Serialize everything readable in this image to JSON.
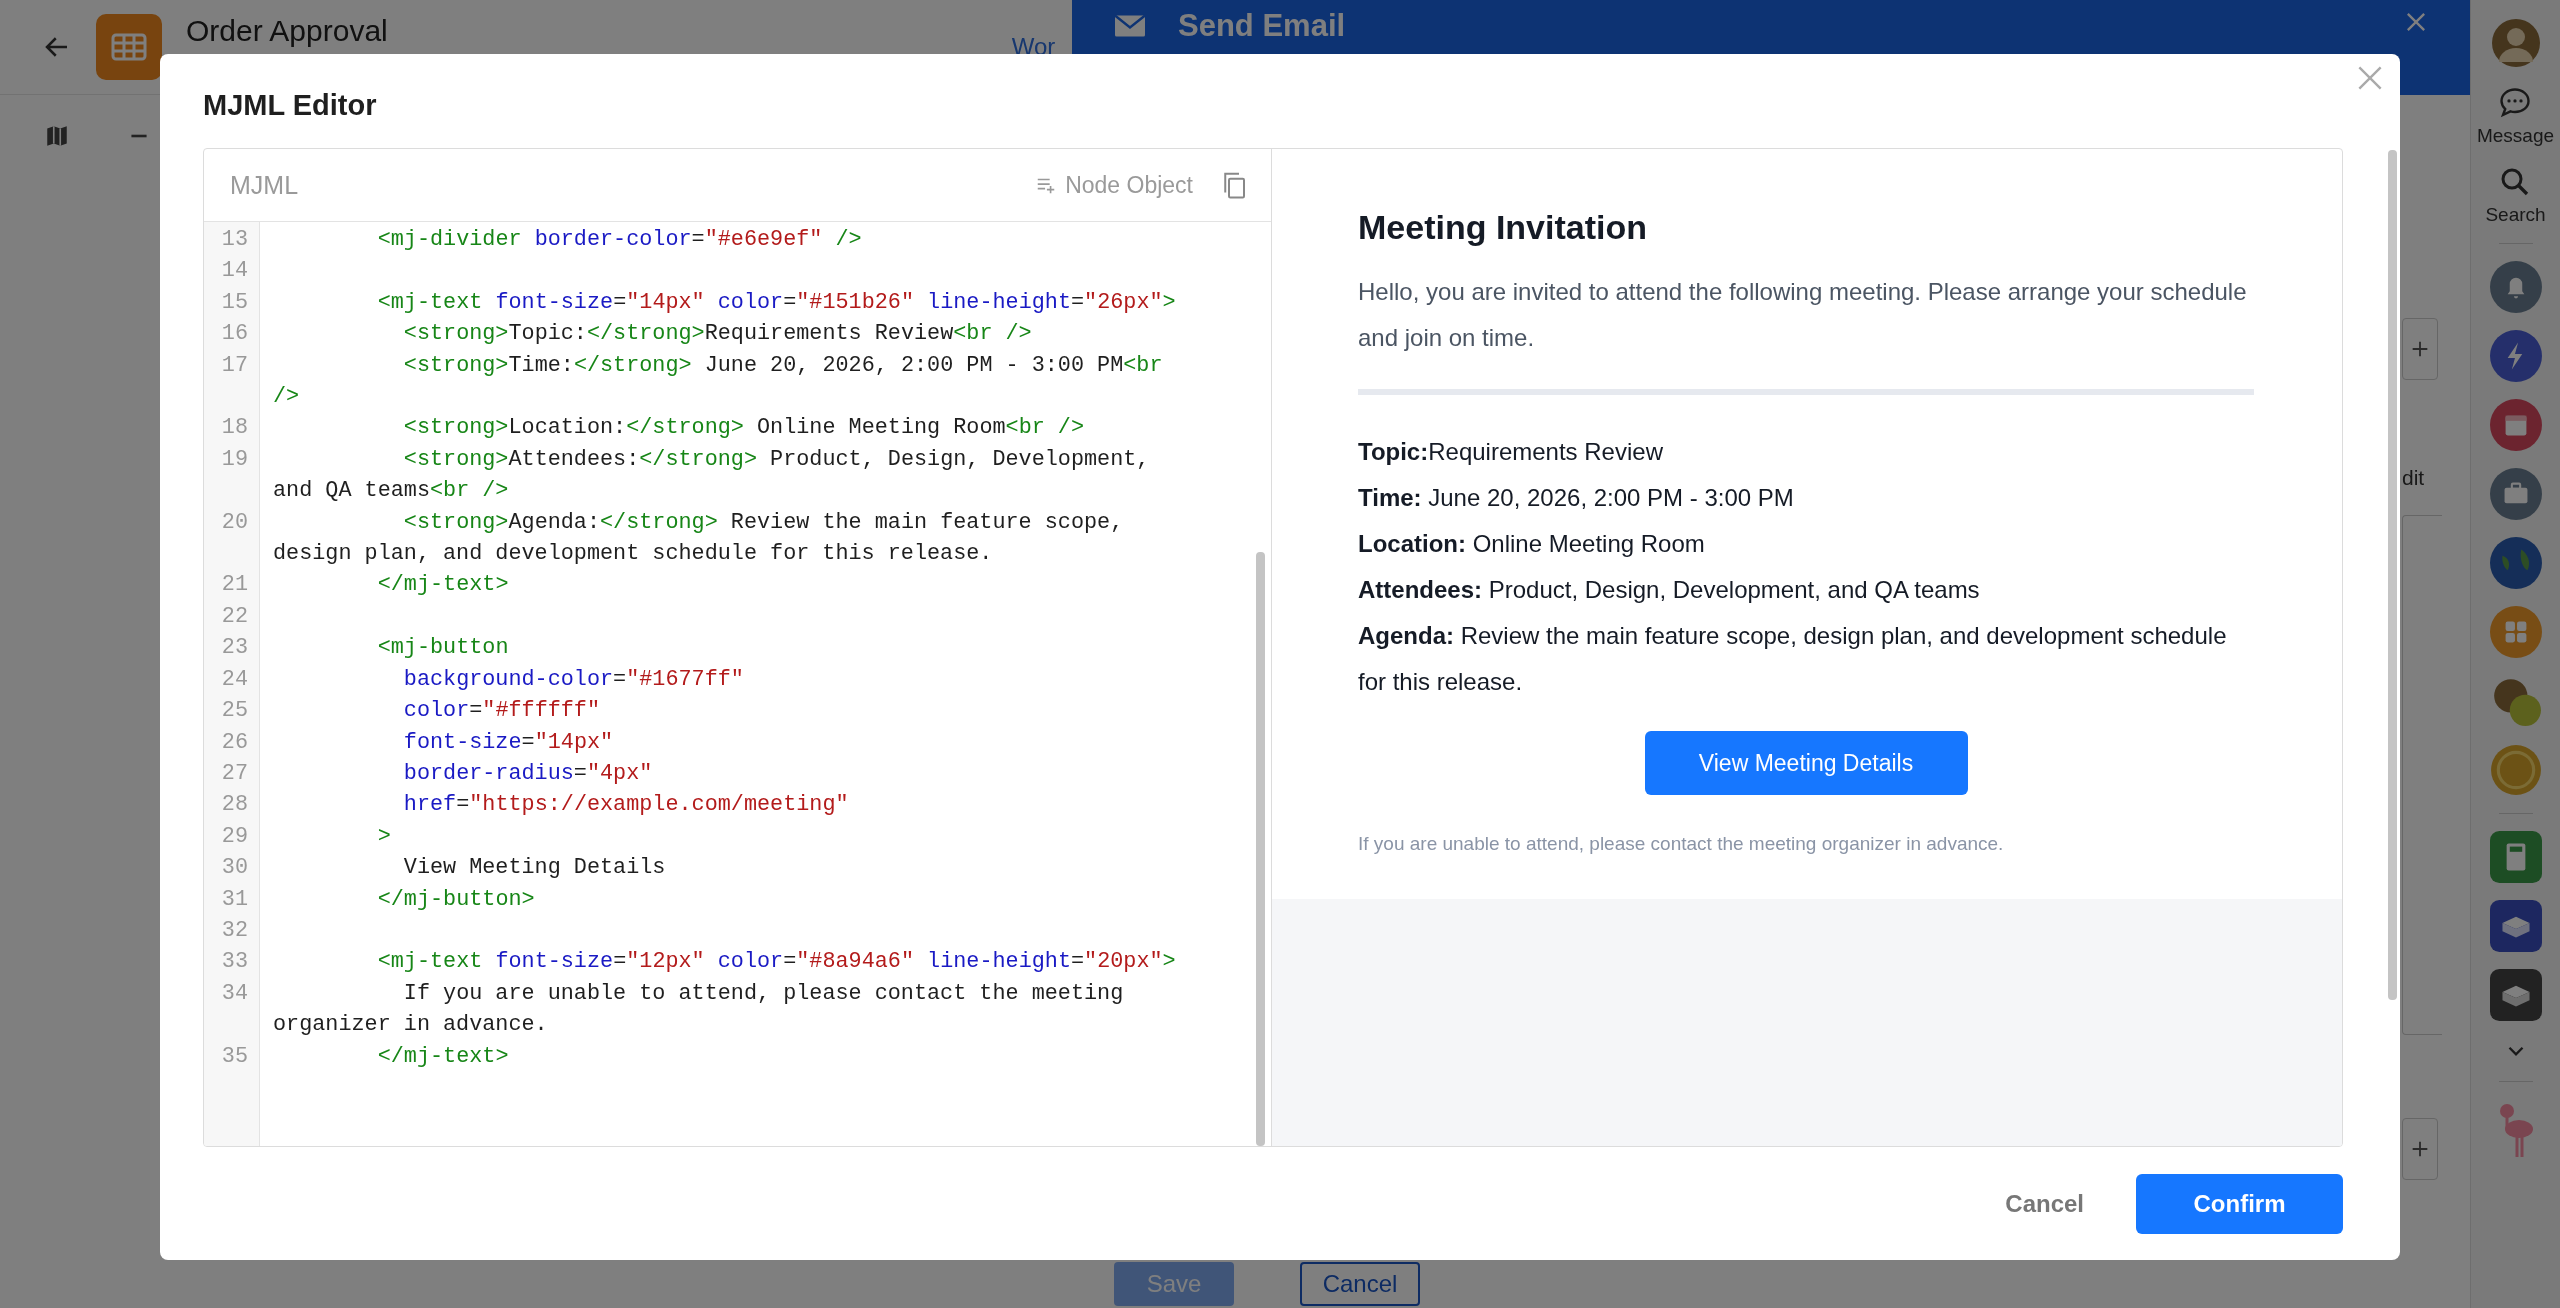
{
  "app": {
    "title": "Order Approval",
    "link": "Wor"
  },
  "drawer": {
    "title": "Send Email",
    "edit_label": "dit",
    "buttons": [
      {
        "label": "Save",
        "kind": "primary",
        "disabled": true
      },
      {
        "label": "Cancel",
        "kind": "outline",
        "disabled": false
      }
    ]
  },
  "sidebar": {
    "items": [
      {
        "label": "Message"
      },
      {
        "label": "Search"
      }
    ]
  },
  "modal": {
    "title": "MJML Editor",
    "editor": {
      "label": "MJML",
      "action": "Node Object",
      "lines": [
        {
          "number": "13",
          "tokens": [
            {
              "kind": "tag",
              "text": "        <mj-divider "
            },
            {
              "kind": "attr",
              "text": "border-color"
            },
            {
              "kind": "text",
              "text": "="
            },
            {
              "kind": "value",
              "text": "\"#e6e9ef\" "
            },
            {
              "kind": "tag",
              "text": "/>"
            }
          ]
        },
        {
          "number": "14"
        },
        {
          "number": "15",
          "tokens": [
            {
              "kind": "tag",
              "text": "        <mj-text "
            },
            {
              "kind": "attr",
              "text": "font-size"
            },
            {
              "kind": "text",
              "text": "="
            },
            {
              "kind": "value",
              "text": "\"14px\" "
            },
            {
              "kind": "attr",
              "text": "color"
            },
            {
              "kind": "text",
              "text": "="
            },
            {
              "kind": "value",
              "text": "\"#151b26\" "
            },
            {
              "kind": "attr",
              "text": "line-height"
            },
            {
              "kind": "text",
              "text": "="
            },
            {
              "kind": "value",
              "text": "\"26px\""
            },
            {
              "kind": "tag",
              "text": ">"
            }
          ]
        },
        {
          "number": "16",
          "tokens": [
            {
              "kind": "tag",
              "text": "          <strong>"
            },
            {
              "kind": "text",
              "text": "Topic:"
            },
            {
              "kind": "tag",
              "text": "</strong>"
            },
            {
              "kind": "text",
              "text": "Requirements Review"
            },
            {
              "kind": "tag",
              "text": "<br />"
            }
          ]
        },
        {
          "number": "17",
          "tokens": [
            {
              "kind": "tag",
              "text": "          <strong>"
            },
            {
              "kind": "text",
              "text": "Time:"
            },
            {
              "kind": "tag",
              "text": "</strong>"
            },
            {
              "kind": "text",
              "text": " June 20, 2026, 2:00 PM - 3:00 PM"
            },
            {
              "kind": "tag",
              "text": "<br />"
            }
          ]
        },
        {
          "number": "18",
          "tokens": [
            {
              "kind": "tag",
              "text": "          <strong>"
            },
            {
              "kind": "text",
              "text": "Location:"
            },
            {
              "kind": "tag",
              "text": "</strong>"
            },
            {
              "kind": "text",
              "text": " Online Meeting Room"
            },
            {
              "kind": "tag",
              "text": "<br />"
            }
          ]
        },
        {
          "number": "19",
          "tokens": [
            {
              "kind": "tag",
              "text": "          <strong>"
            },
            {
              "kind": "text",
              "text": "Attendees:"
            },
            {
              "kind": "tag",
              "text": "</strong>"
            },
            {
              "kind": "text",
              "text": " Product, Design, Development, and QA teams"
            },
            {
              "kind": "tag",
              "text": "<br />"
            }
          ]
        },
        {
          "number": "20",
          "tokens": [
            {
              "kind": "tag",
              "text": "          <strong>"
            },
            {
              "kind": "text",
              "text": "Agenda:"
            },
            {
              "kind": "tag",
              "text": "</strong>"
            },
            {
              "kind": "text",
              "text": " Review the main feature scope, design plan, and development schedule for this release."
            }
          ]
        },
        {
          "number": "21",
          "tokens": [
            {
              "kind": "tag",
              "text": "        </mj-text>"
            }
          ]
        },
        {
          "number": "22"
        },
        {
          "number": "23",
          "tokens": [
            {
              "kind": "tag",
              "text": "        <mj-button"
            }
          ]
        },
        {
          "number": "24",
          "tokens": [
            {
              "kind": "attr",
              "text": "          background-color"
            },
            {
              "kind": "text",
              "text": "="
            },
            {
              "kind": "value",
              "text": "\"#1677ff\""
            }
          ]
        },
        {
          "number": "25",
          "tokens": [
            {
              "kind": "attr",
              "text": "          color"
            },
            {
              "kind": "text",
              "text": "="
            },
            {
              "kind": "value",
              "text": "\"#ffffff\""
            }
          ]
        },
        {
          "number": "26",
          "tokens": [
            {
              "kind": "attr",
              "text": "          font-size"
            },
            {
              "kind": "text",
              "text": "="
            },
            {
              "kind": "value",
              "text": "\"14px\""
            }
          ]
        },
        {
          "number": "27",
          "tokens": [
            {
              "kind": "attr",
              "text": "          border-radius"
            },
            {
              "kind": "text",
              "text": "="
            },
            {
              "kind": "value",
              "text": "\"4px\""
            }
          ]
        },
        {
          "number": "28",
          "tokens": [
            {
              "kind": "attr",
              "text": "          href"
            },
            {
              "kind": "text",
              "text": "="
            },
            {
              "kind": "value",
              "text": "\"https://example.com/meeting\""
            }
          ]
        },
        {
          "number": "29",
          "tokens": [
            {
              "kind": "tag",
              "text": "        >"
            }
          ]
        },
        {
          "number": "30",
          "tokens": [
            {
              "kind": "text",
              "text": "          View Meeting Details"
            }
          ]
        },
        {
          "number": "31",
          "tokens": [
            {
              "kind": "tag",
              "text": "        </mj-button>"
            }
          ]
        },
        {
          "number": "32"
        },
        {
          "number": "33",
          "tokens": [
            {
              "kind": "tag",
              "text": "        <mj-text "
            },
            {
              "kind": "attr",
              "text": "font-size"
            },
            {
              "kind": "text",
              "text": "="
            },
            {
              "kind": "value",
              "text": "\"12px\" "
            },
            {
              "kind": "attr",
              "text": "color"
            },
            {
              "kind": "text",
              "text": "="
            },
            {
              "kind": "value",
              "text": "\"#8a94a6\" "
            },
            {
              "kind": "attr",
              "text": "line-height"
            },
            {
              "kind": "text",
              "text": "="
            },
            {
              "kind": "value",
              "text": "\"20px\""
            },
            {
              "kind": "tag",
              "text": ">"
            }
          ]
        },
        {
          "number": "34",
          "tokens": [
            {
              "kind": "text",
              "text": "          If you are unable to attend, please contact the meeting organizer in advance."
            }
          ]
        },
        {
          "number": "35",
          "tokens": [
            {
              "kind": "tag",
              "text": "        </mj-text>"
            }
          ]
        }
      ]
    },
    "preview": {
      "heading": "Meeting Invitation",
      "intro": "Hello, you are invited to attend the following meeting. Please arrange your schedule and join on time.",
      "details": [
        "**Topic:**Requirements Review",
        "**Time:** June 20, 2026, 2:00 PM - 3:00 PM",
        "**Location:** Online Meeting Room",
        "**Attendees:** Product, Design, Development, and QA teams",
        "**Agenda:** Review the main feature scope, design plan, and development schedule for this release."
      ],
      "button": "View Meeting Details",
      "note": "If you are unable to attend, please contact the meeting organizer in advance."
    },
    "buttons": [
      {
        "label": "Cancel",
        "kind": "text"
      },
      {
        "label": "Confirm",
        "kind": "primary"
      }
    ]
  }
}
